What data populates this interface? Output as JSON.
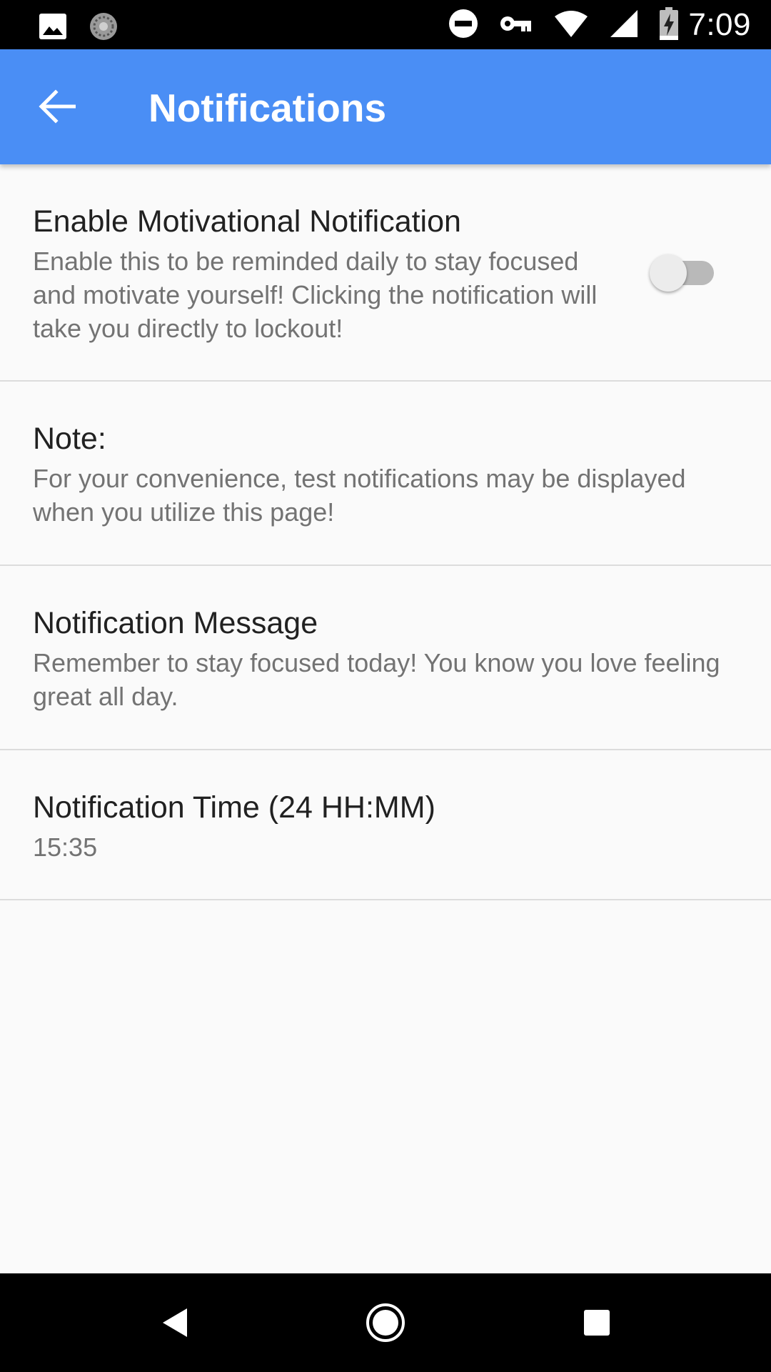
{
  "status_bar": {
    "time": "7:09",
    "left_icons": [
      "image-icon",
      "sync-icon"
    ],
    "right_icons": [
      "do-not-disturb-icon",
      "vpn-key-icon",
      "wifi-icon",
      "signal-icon",
      "battery-charging-icon"
    ]
  },
  "app_bar": {
    "title": "Notifications",
    "back_icon": "arrow-back-icon",
    "color": "#4a8ef5"
  },
  "settings": {
    "motivational": {
      "title": "Enable Motivational Notification",
      "summary": "Enable this to be reminded daily to stay focused and motivate yourself! Clicking the notification will take you directly to lockout!",
      "enabled": false
    },
    "note": {
      "title": "Note:",
      "summary": "For your convenience, test notifications may be displayed when you utilize this page!"
    },
    "message": {
      "title": "Notification Message",
      "summary": "Remember to stay focused today! You know you love feeling great all day."
    },
    "time": {
      "title": "Notification Time (24 HH:MM)",
      "summary": "15:35"
    }
  },
  "nav_bar": {
    "icons": [
      "nav-back-icon",
      "nav-home-icon",
      "nav-recents-icon"
    ]
  }
}
